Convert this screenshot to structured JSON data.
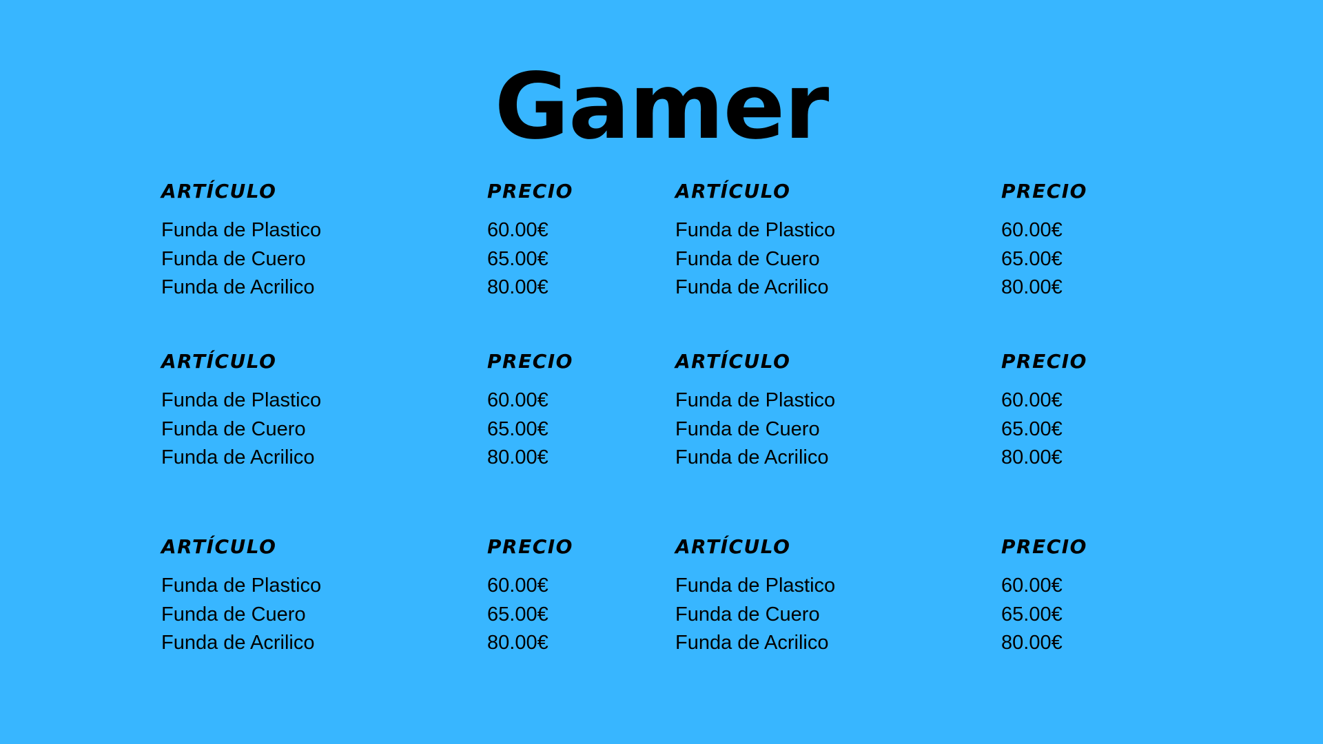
{
  "title": "Gamer",
  "blocks": [
    {
      "header_item": "ARTÍCULO",
      "header_price": "PRECIO",
      "rows": [
        {
          "item": "Funda de Plastico",
          "price": "60.00€"
        },
        {
          "item": "Funda de Cuero",
          "price": "65.00€"
        },
        {
          "item": "Funda de Acrilico",
          "price": "80.00€"
        }
      ]
    },
    {
      "header_item": "ARTÍCULO",
      "header_price": "PRECIO",
      "rows": [
        {
          "item": "Funda de Plastico",
          "price": "60.00€"
        },
        {
          "item": "Funda de Cuero",
          "price": "65.00€"
        },
        {
          "item": "Funda de Acrilico",
          "price": "80.00€"
        }
      ]
    },
    {
      "header_item": "ARTÍCULO",
      "header_price": "PRECIO",
      "rows": [
        {
          "item": "Funda de Plastico",
          "price": "60.00€"
        },
        {
          "item": "Funda de Cuero",
          "price": "65.00€"
        },
        {
          "item": "Funda de Acrilico",
          "price": "80.00€"
        }
      ]
    },
    {
      "header_item": "ARTÍCULO",
      "header_price": "PRECIO",
      "rows": [
        {
          "item": "Funda de Plastico",
          "price": "60.00€"
        },
        {
          "item": "Funda de Cuero",
          "price": "65.00€"
        },
        {
          "item": "Funda de Acrilico",
          "price": "80.00€"
        }
      ]
    },
    {
      "header_item": "ARTÍCULO",
      "header_price": "PRECIO",
      "rows": [
        {
          "item": "Funda de Plastico",
          "price": "60.00€"
        },
        {
          "item": "Funda de Cuero",
          "price": "65.00€"
        },
        {
          "item": "Funda de Acrilico",
          "price": "80.00€"
        }
      ]
    },
    {
      "header_item": "ARTÍCULO",
      "header_price": "PRECIO",
      "rows": [
        {
          "item": "Funda de Plastico",
          "price": "60.00€"
        },
        {
          "item": "Funda de Cuero",
          "price": "65.00€"
        },
        {
          "item": "Funda de Acrilico",
          "price": "80.00€"
        }
      ]
    }
  ],
  "colors": {
    "background": "#38b6ff",
    "text": "#000000"
  }
}
